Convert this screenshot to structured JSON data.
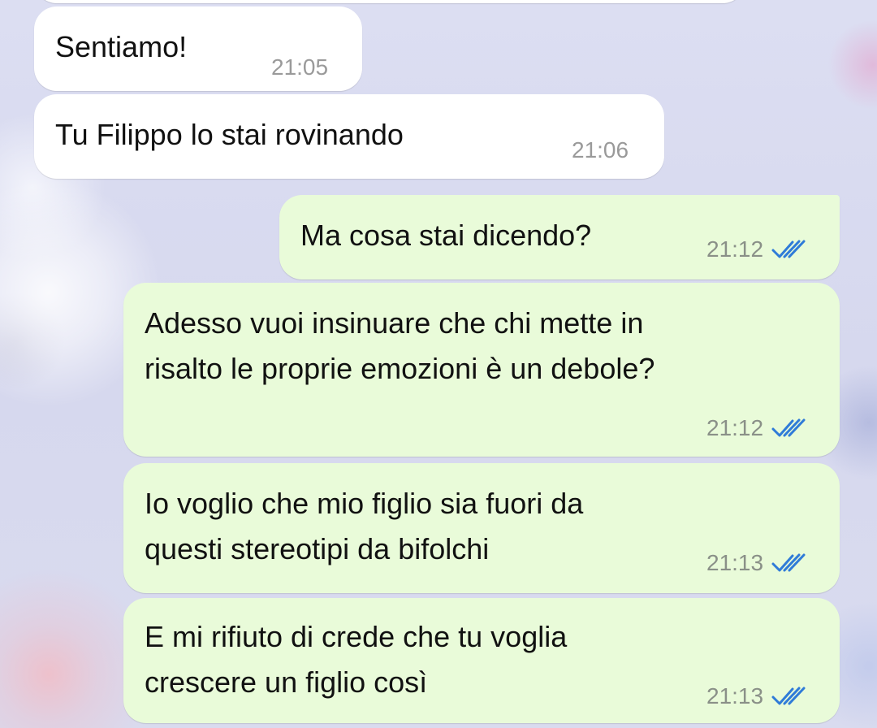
{
  "messages": [
    {
      "direction": "incoming",
      "text": "Sentiamo!",
      "time": "21:05"
    },
    {
      "direction": "incoming",
      "text": "Tu Filippo lo stai rovinando",
      "time": "21:06"
    },
    {
      "direction": "outgoing",
      "text": "Ma cosa stai dicendo?",
      "time": "21:12",
      "status": "read-double-check-icon"
    },
    {
      "direction": "outgoing",
      "text": "Adesso vuoi insinuare che chi mette in\nrisalto le proprie emozioni è un debole?",
      "time": "21:12",
      "status": "read-double-check-icon"
    },
    {
      "direction": "outgoing",
      "text": "Io voglio che mio figlio sia fuori da\nquesti stereotipi da bifolchi",
      "time": "21:13",
      "status": "read-double-check-icon"
    },
    {
      "direction": "outgoing",
      "text": "E mi rifiuto di crede che tu voglia\ncrescere un figlio così",
      "time": "21:13",
      "status": "read-double-check-icon"
    }
  ],
  "colors": {
    "incoming_bubble": "#ffffff",
    "outgoing_bubble": "#e9fbd9",
    "read_tick": "#2f7bd8"
  }
}
